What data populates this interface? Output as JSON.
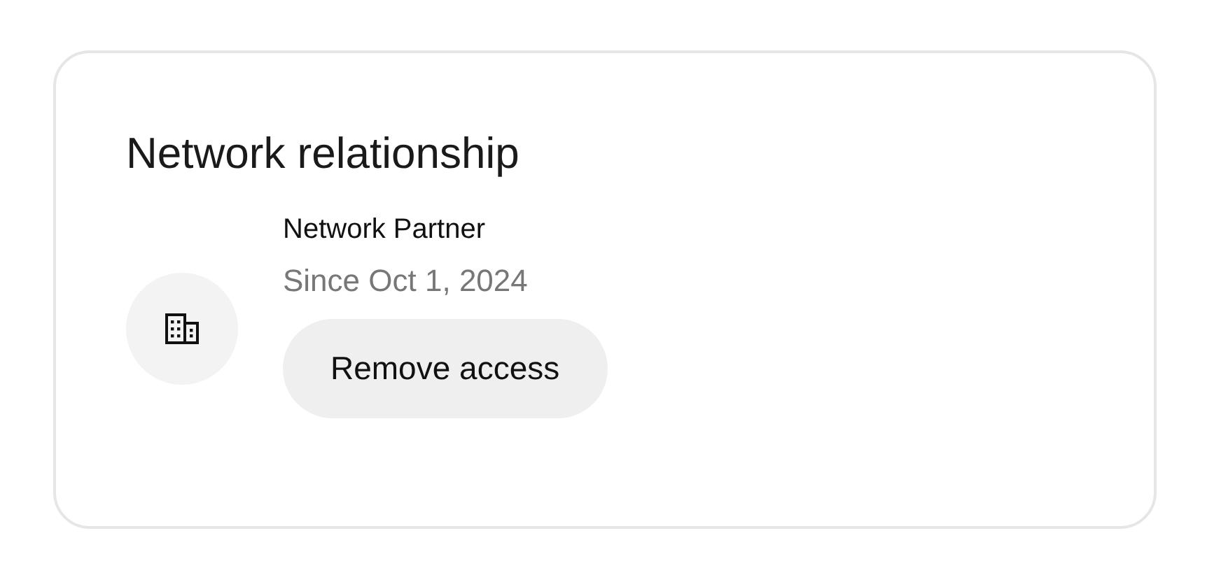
{
  "card": {
    "title": "Network relationship",
    "partner": {
      "name": "Network Partner",
      "since": "Since Oct 1, 2024"
    },
    "buttons": [
      "Remove access"
    ]
  }
}
